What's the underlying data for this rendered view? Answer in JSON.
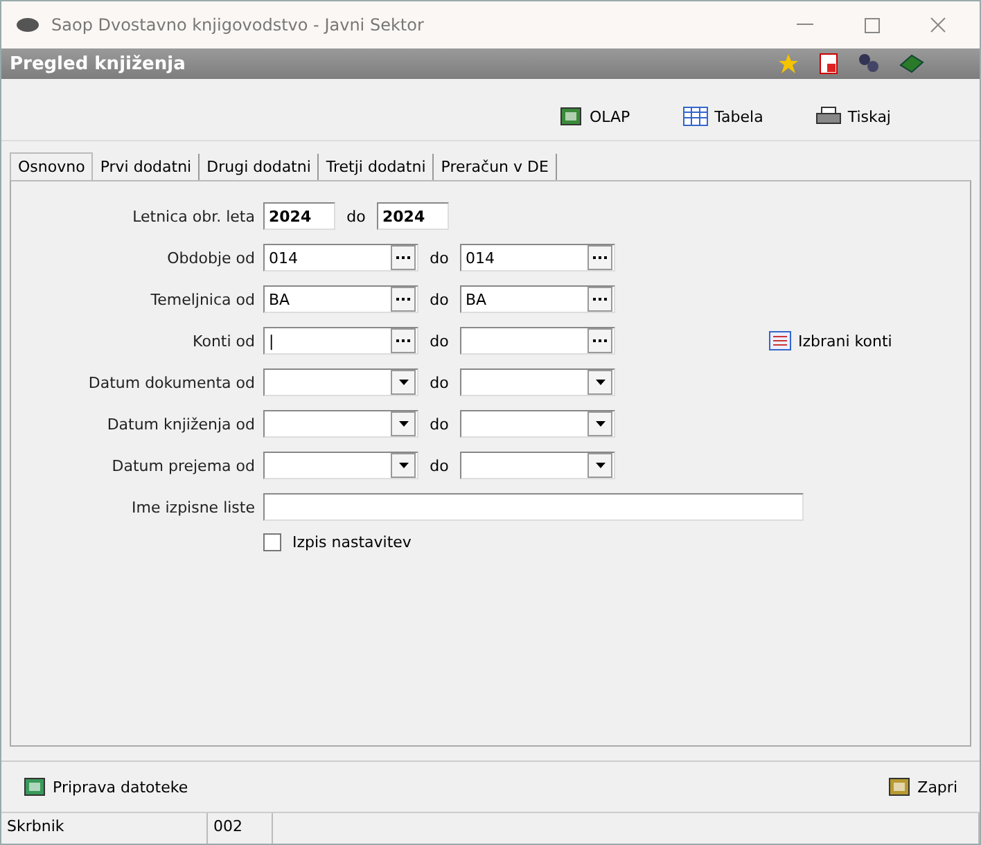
{
  "window": {
    "title": "Saop Dvostavno knjigovodstvo - Javni Sektor"
  },
  "header": {
    "title": "Pregled knjiženja"
  },
  "toolbar": [
    {
      "label": "OLAP",
      "kind": "olap"
    },
    {
      "label": "Tabela",
      "kind": "table"
    },
    {
      "label": "Tiskaj",
      "kind": "print"
    }
  ],
  "tabs": [
    {
      "label": "Osnovno",
      "selected": true
    },
    {
      "label": "Prvi dodatni",
      "selected": false
    },
    {
      "label": "Drugi dodatni",
      "selected": false
    },
    {
      "label": "Tretji dodatni",
      "selected": false
    },
    {
      "label": "Preračun v DE",
      "selected": false
    }
  ],
  "range_rows": [
    {
      "label": "Letnica obr. leta",
      "kind": "year",
      "from": "2024",
      "separator": "do",
      "to": "2024"
    },
    {
      "label": "Obdobje od",
      "kind": "picker",
      "from": "014",
      "separator": "do",
      "to": "014"
    },
    {
      "label": "Temeljnica od",
      "kind": "picker",
      "from": "BA",
      "separator": "do",
      "to": "BA"
    },
    {
      "label": "Konti od",
      "kind": "picker",
      "from": "|",
      "separator": "do",
      "to": ""
    },
    {
      "label": "Datum dokumenta od",
      "kind": "date",
      "separator": "do"
    },
    {
      "label": "Datum knjiženja od",
      "kind": "date",
      "separator": "do"
    },
    {
      "label": "Datum prejema od",
      "kind": "date",
      "separator": "do"
    }
  ],
  "selected_accounts_button": {
    "label": "Izbrani konti"
  },
  "list_name": {
    "label": "Ime izpisne liste"
  },
  "print_settings": {
    "label": "Izpis nastavitev",
    "checked": false
  },
  "footer": {
    "prepare_button": "Priprava datoteke",
    "close_button": "Zapri"
  },
  "status_bar": {
    "user_label": "Skrbnik",
    "user_code": "002"
  }
}
